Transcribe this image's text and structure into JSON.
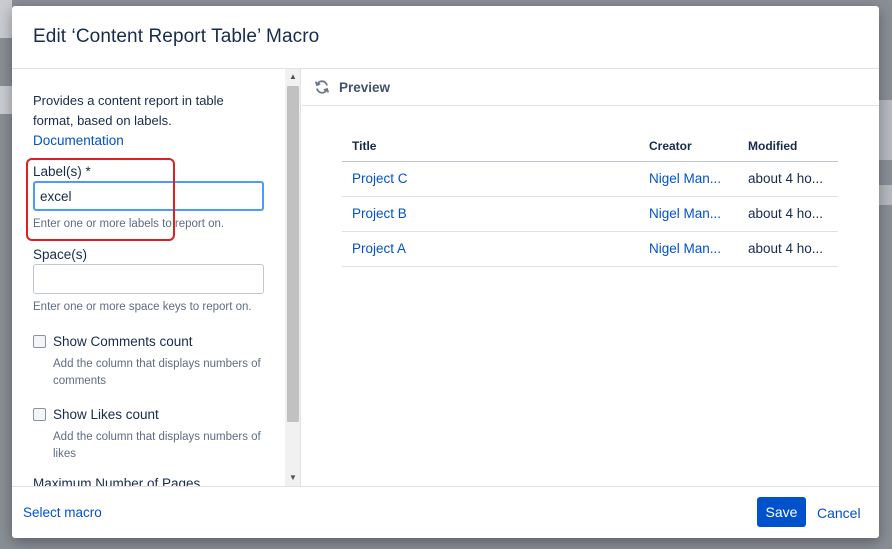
{
  "dialog": {
    "title": "Edit ‘Content Report Table’ Macro"
  },
  "form": {
    "description": "Provides a content report in table format, based on labels.",
    "documentation_link": "Documentation",
    "labels": {
      "label": "Label(s) *",
      "value": "excel",
      "help": "Enter one or more labels to report on."
    },
    "spaces": {
      "label": "Space(s)",
      "value": "",
      "help": "Enter one or more space keys to report on."
    },
    "show_comments": {
      "label": "Show Comments count",
      "checked": false,
      "help": "Add the column that displays numbers of comments"
    },
    "show_likes": {
      "label": "Show Likes count",
      "checked": false,
      "help": "Add the column that displays numbers of likes"
    },
    "max_pages_label": "Maximum Number of Pages"
  },
  "preview": {
    "label": "Preview",
    "columns": [
      "Title",
      "Creator",
      "Modified"
    ],
    "rows": [
      {
        "title": "Project C",
        "creator": "Nigel Man...",
        "modified": "about 4 ho..."
      },
      {
        "title": "Project B",
        "creator": "Nigel Man...",
        "modified": "about 4 ho..."
      },
      {
        "title": "Project A",
        "creator": "Nigel Man...",
        "modified": "about 4 ho..."
      }
    ]
  },
  "footer": {
    "select_macro": "Select macro",
    "save": "Save",
    "cancel": "Cancel"
  },
  "colors": {
    "accent": "#0052cc",
    "highlight": "#e02020",
    "focus_border": "#4c9aff"
  }
}
